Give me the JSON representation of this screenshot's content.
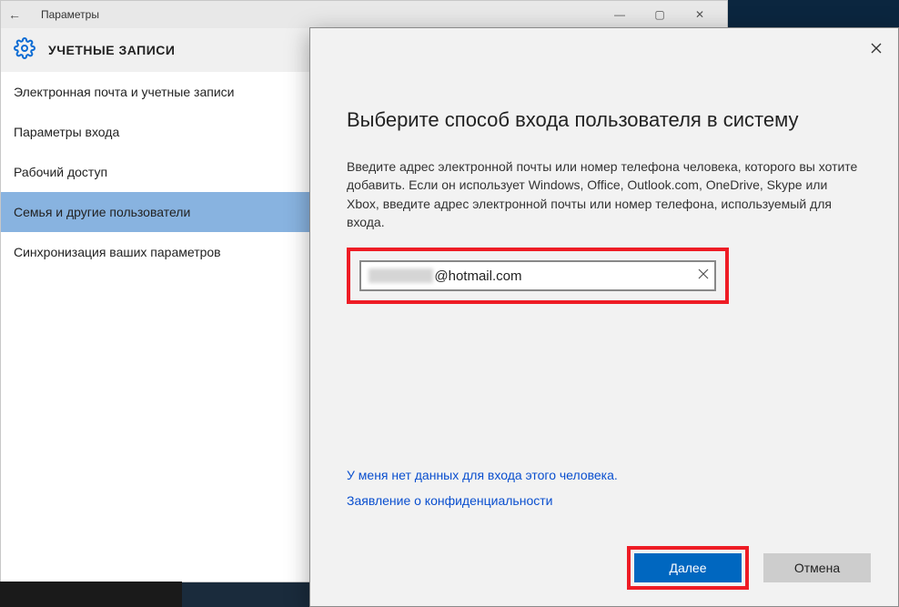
{
  "settings": {
    "window_title": "Параметры",
    "header_title": "УЧЕТНЫЕ ЗАПИСИ",
    "sidebar_items": [
      "Электронная почта и учетные записи",
      "Параметры входа",
      "Рабочий доступ",
      "Семья и другие пользователи",
      "Синхронизация ваших параметров"
    ],
    "selected_index": 3
  },
  "dialog": {
    "title": "Выберите способ входа пользователя в систему",
    "description": "Введите адрес электронной почты или номер телефона человека, которого вы хотите добавить. Если он использует Windows, Office, Outlook.com, OneDrive, Skype или Xbox, введите адрес электронной почты или номер телефона, используемый для входа.",
    "email_visible_suffix": "@hotmail.com",
    "link_no_credentials": "У меня нет данных для входа этого человека.",
    "link_privacy": "Заявление о конфиденциальности",
    "btn_next": "Далее",
    "btn_cancel": "Отмена"
  }
}
